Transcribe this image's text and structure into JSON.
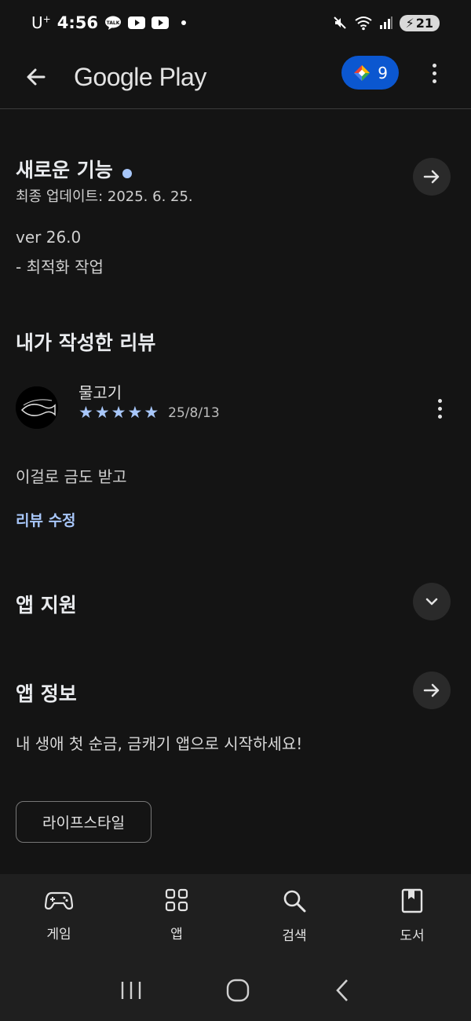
{
  "status": {
    "carrier": "U",
    "carrier_sup": "+",
    "time": "4:56",
    "battery": "21"
  },
  "header": {
    "title": "Google Play",
    "points": "9"
  },
  "whats_new": {
    "title": "새로운 기능",
    "updated": "최종 업데이트: 2025. 6. 25.",
    "version": "ver 26.0",
    "notes": "- 최적화 작업"
  },
  "my_review": {
    "title": "내가 작성한 리뷰",
    "user": "물고기",
    "rating": 5,
    "date": "25/8/13",
    "body": "이걸로 금도 받고",
    "edit_label": "리뷰 수정"
  },
  "app_support": {
    "title": "앱 지원"
  },
  "app_info": {
    "title": "앱 정보",
    "description": "내 생애 첫 순금, 금캐기 앱으로 시작하세요!",
    "chip": "라이프스타일"
  },
  "bottom_nav": {
    "items": [
      {
        "label": "게임",
        "icon": "gamepad-icon"
      },
      {
        "label": "앱",
        "icon": "apps-grid-icon"
      },
      {
        "label": "검색",
        "icon": "search-icon"
      },
      {
        "label": "도서",
        "icon": "book-icon"
      }
    ]
  },
  "colors": {
    "background": "#141414",
    "accent": "#a8c7fa",
    "points_pill": "#0b57d0"
  }
}
